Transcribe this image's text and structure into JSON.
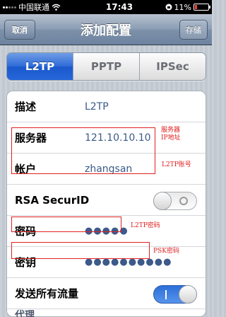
{
  "status_bar": {
    "carrier": "中国联通",
    "time": "17:43",
    "battery": "11%"
  },
  "nav": {
    "title": "添加配置",
    "cancel_label": "取消",
    "save_label": "存储"
  },
  "tabs": [
    {
      "label": "L2TP",
      "active": true
    },
    {
      "label": "PPTP",
      "active": false
    },
    {
      "label": "IPSec",
      "active": false
    }
  ],
  "form": {
    "description": {
      "label": "描述",
      "value": "L2TP"
    },
    "server": {
      "label": "服务器",
      "value": "121.10.10.10"
    },
    "account": {
      "label": "帐户",
      "value": "zhangsan"
    },
    "rsa": {
      "label": "RSA SecurID",
      "enabled": false
    },
    "password": {
      "label": "密码",
      "value": "●●●●●"
    },
    "secret": {
      "label": "密钥",
      "value": "●●●●●●●●●●"
    },
    "send_all": {
      "label": "发送所有流量",
      "enabled": true
    },
    "proxy": {
      "label": "代理"
    }
  },
  "annotations": {
    "server": "服务器",
    "ip": "IP地址",
    "account": "L2TP账号",
    "password": "L2TP密码",
    "psk": "PSK密码"
  },
  "colors": {
    "accent": "#2667da",
    "annotation": "#e02020"
  }
}
